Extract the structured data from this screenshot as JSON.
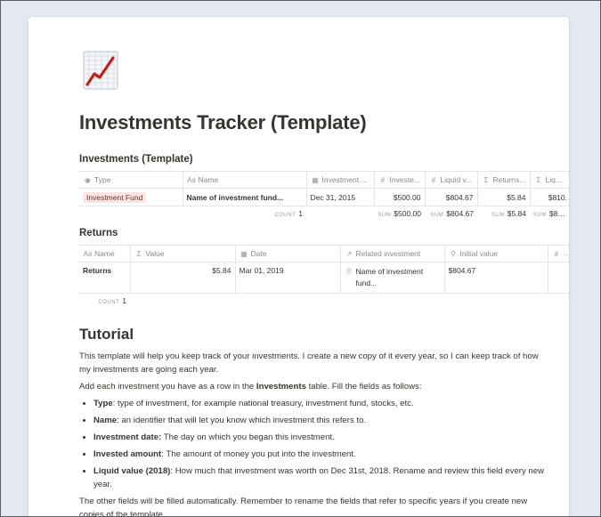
{
  "page": {
    "icon": "chart-increasing-icon",
    "title": "Investments Tracker (Template)"
  },
  "investments": {
    "title": "Investments (Template)",
    "columns": [
      {
        "icon": "select-icon",
        "label": "Type"
      },
      {
        "icon": "text-icon",
        "label": "Name"
      },
      {
        "icon": "calendar-icon",
        "label": "Investment ..."
      },
      {
        "icon": "number-icon",
        "label": "Investe..."
      },
      {
        "icon": "number-icon",
        "label": "Liquid v..."
      },
      {
        "icon": "formula-icon",
        "label": "Returns..."
      },
      {
        "icon": "formula-icon",
        "label": "Liquid v"
      }
    ],
    "rows": [
      {
        "type": "Investment Fund",
        "name": "Name of investment fund...",
        "date": "Dec 31, 2015",
        "invested": "$500.00",
        "liquid": "$804.67",
        "returns": "$5.84",
        "liquid2": "$810."
      }
    ],
    "footer": {
      "count_label": "COUNT",
      "count_value": "1",
      "sum_label": "SUM",
      "sum_invested": "$500.00",
      "sum_liquid": "$804.67",
      "sum_returns": "$5.84",
      "sum_liquid2": "$810."
    },
    "colors": {
      "tag_bg": "#fbe4e1"
    }
  },
  "returns": {
    "title": "Returns",
    "columns": [
      {
        "icon": "text-icon",
        "label": "Name"
      },
      {
        "icon": "sigma-icon",
        "label": "Value"
      },
      {
        "icon": "calendar-icon",
        "label": "Date"
      },
      {
        "icon": "relation-arrow-icon",
        "label": "Related investment"
      },
      {
        "icon": "search-icon",
        "label": "Initial value"
      },
      {
        "icon": "number-icon",
        "label": "C"
      }
    ],
    "rows": [
      {
        "name": "Returns",
        "value": "$5.84",
        "date": "Mar 01, 2019",
        "related_line1": "Name of investment",
        "related_line2": "fund...",
        "initial": "$804.67"
      }
    ],
    "footer": {
      "count_label": "COUNT",
      "count_value": "1"
    }
  },
  "tutorial": {
    "heading": "Tutorial",
    "p1": "This template will help you keep track of your investments. I create a new copy of it every year, so I can keep track of how my investments are going each year.",
    "p2_pre": "Add each investment you have as a row in the ",
    "p2_bold": "Investments",
    "p2_post": " table. Fill the fields as follows:",
    "items": [
      {
        "term": "Type",
        "text": ": type of investment, for example national treasury, investment fund, stocks, etc."
      },
      {
        "term": "Name",
        "text": ": an identifier that will let you know which investment this refers to."
      },
      {
        "term": "Investment date:",
        "text": " The day on which you began this investment."
      },
      {
        "term": "Invested amount",
        "text": ": The amount of money you put into the investment."
      },
      {
        "term": "Liquid value (2018)",
        "text": ": How much that investment was worth on Dec 31st, 2018. Rename and review this field every new year."
      }
    ],
    "p3": "The other fields will be filled automatically. Remember to rename the fields that refer to specific years if you create new copies of the template."
  }
}
